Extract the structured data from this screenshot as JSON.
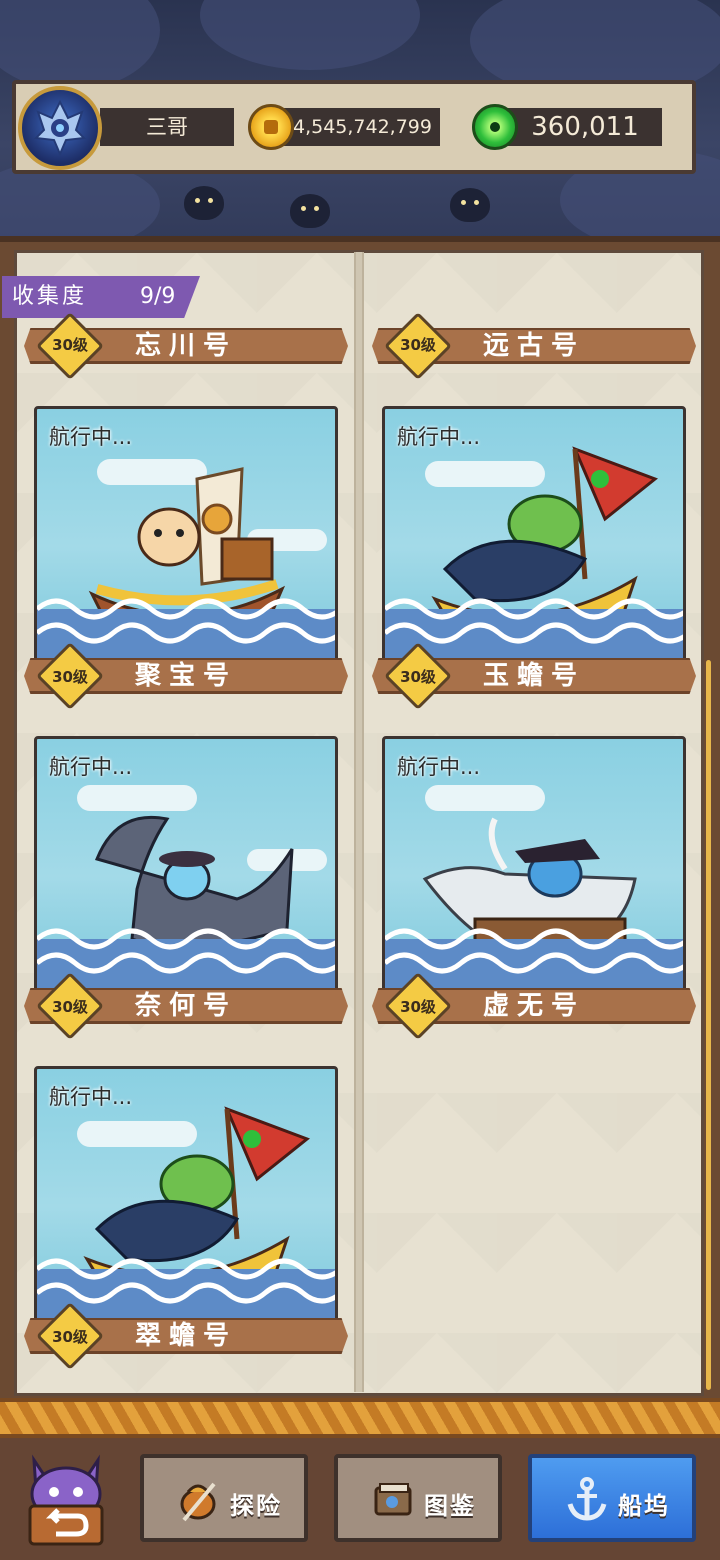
{
  "player": {
    "name": "三哥"
  },
  "currency": {
    "gold": "4,545,742,799",
    "gems": "360,011"
  },
  "collection": {
    "label": "收集度",
    "value": "9/9"
  },
  "status_text": "航行中...",
  "ships": [
    {
      "name": "忘川号",
      "level": "30级"
    },
    {
      "name": "远古号",
      "level": "30级"
    },
    {
      "name": "聚宝号",
      "level": "30级"
    },
    {
      "name": "玉蟾号",
      "level": "30级"
    },
    {
      "name": "奈何号",
      "level": "30级"
    },
    {
      "name": "虚无号",
      "level": "30级"
    },
    {
      "name": "翠蟾号",
      "level": "30级"
    }
  ],
  "nav": {
    "explore": "探险",
    "catalog": "图鉴",
    "dock": "船坞",
    "active": "dock"
  },
  "colors": {
    "panel": "#e7e1d1",
    "nameplate": "#a8714a",
    "active_tab": "#2d6fd8",
    "collect_tab": "#7e59b0"
  }
}
